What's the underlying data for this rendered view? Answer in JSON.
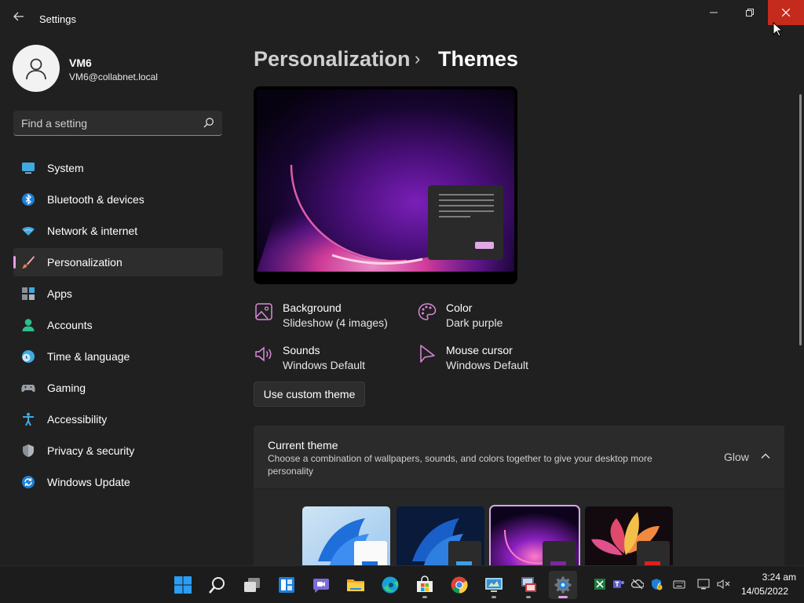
{
  "window": {
    "title": "Settings",
    "controls": {
      "minimize_icon": "minimize-icon",
      "maximize_icon": "restore-icon",
      "close_icon": "close-icon"
    }
  },
  "user": {
    "name": "VM6",
    "email": "VM6@collabnet.local"
  },
  "search": {
    "placeholder": "Find a setting"
  },
  "nav": [
    {
      "label": "System",
      "icon": "monitor-icon"
    },
    {
      "label": "Bluetooth & devices",
      "icon": "bluetooth-icon"
    },
    {
      "label": "Network & internet",
      "icon": "wifi-icon"
    },
    {
      "label": "Personalization",
      "icon": "brush-icon",
      "active": true
    },
    {
      "label": "Apps",
      "icon": "apps-icon"
    },
    {
      "label": "Accounts",
      "icon": "person-icon"
    },
    {
      "label": "Time & language",
      "icon": "clock-globe-icon"
    },
    {
      "label": "Gaming",
      "icon": "gamepad-icon"
    },
    {
      "label": "Accessibility",
      "icon": "accessibility-icon"
    },
    {
      "label": "Privacy & security",
      "icon": "shield-icon"
    },
    {
      "label": "Windows Update",
      "icon": "update-icon"
    }
  ],
  "breadcrumb": {
    "parent": "Personalization",
    "separator": "›",
    "current": "Themes"
  },
  "theme_props": {
    "background": {
      "title": "Background",
      "value": "Slideshow (4 images)"
    },
    "color": {
      "title": "Color",
      "value": "Dark purple"
    },
    "sounds": {
      "title": "Sounds",
      "value": "Windows Default"
    },
    "cursor": {
      "title": "Mouse cursor",
      "value": "Windows Default"
    }
  },
  "custom_theme_button": "Use custom theme",
  "current_theme": {
    "title": "Current theme",
    "description": "Choose a combination of wallpapers, sounds, and colors together to give your desktop more personality",
    "value": "Glow"
  },
  "theme_thumbnails": [
    "windows-light",
    "windows-dark",
    "glow",
    "captured-motion"
  ],
  "taskbar": {
    "apps": [
      "start-icon",
      "search-icon",
      "task-view-icon",
      "widgets-icon",
      "teams-chat-icon",
      "file-explorer-icon",
      "edge-icon",
      "store-icon",
      "chrome-icon",
      "remote-desktop-icon",
      "network-app-icon",
      "settings-icon"
    ],
    "clock": {
      "time": "3:24 am",
      "date": "14/05/2022"
    }
  },
  "colors": {
    "accent": "#e49ce8",
    "close_red": "#c42b1c",
    "background": "#202020"
  }
}
